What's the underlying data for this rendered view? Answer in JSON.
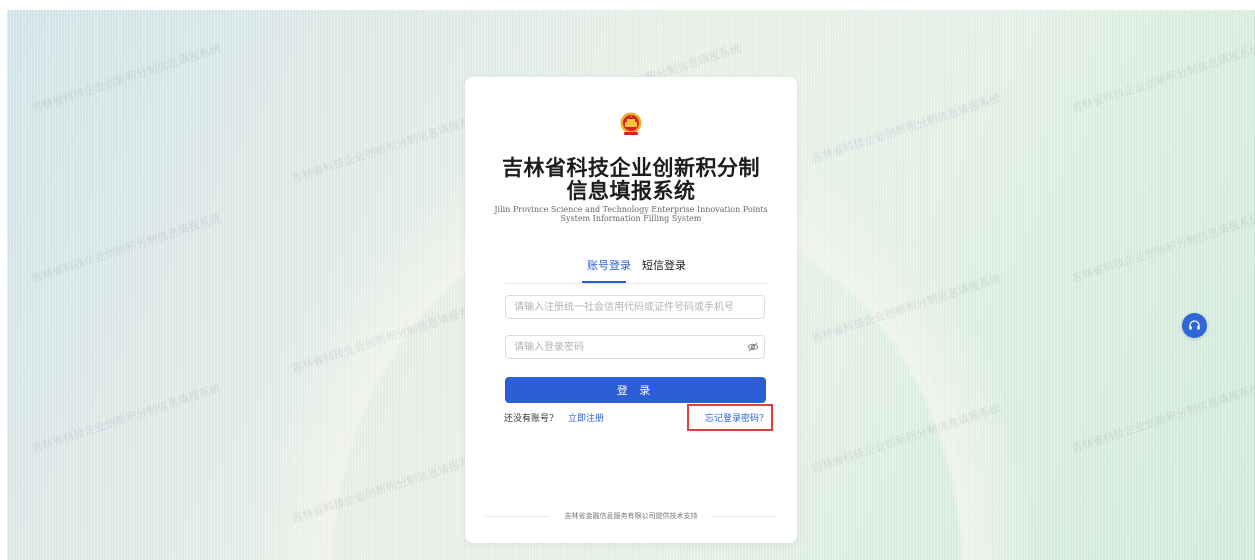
{
  "branding": {
    "emblem_icon": "national-emblem-icon",
    "title_line1": "吉林省科技企业创新积分制",
    "title_line2": "信息填报系统",
    "subtitle_line1": "Jilin Province Science and Technology Enterprise Innovation Points",
    "subtitle_line2": "System Information Filling System"
  },
  "login": {
    "tabs": [
      {
        "label": "账号登录",
        "active": true
      },
      {
        "label": "短信登录",
        "active": false
      }
    ],
    "account_placeholder": "请输入注册统一社会信用代码或证件号码或手机号",
    "account_value": "",
    "password_placeholder": "请输入登录密码",
    "password_value": "",
    "password_toggle_icon": "eye-off-icon",
    "submit_label": "登 录",
    "no_account_text": "还没有账号?",
    "register_link": "立即注册",
    "forgot_link": "忘记登录密码?"
  },
  "footer": {
    "support_text": "吉林省金融信息服务有限公司提供技术支持"
  },
  "floating": {
    "support_icon": "headset-icon"
  },
  "watermark_text": "吉林省科技企业创新积分制信息填报系统",
  "colors": {
    "primary": "#2c5fd6",
    "highlight_border": "#e0403c"
  }
}
